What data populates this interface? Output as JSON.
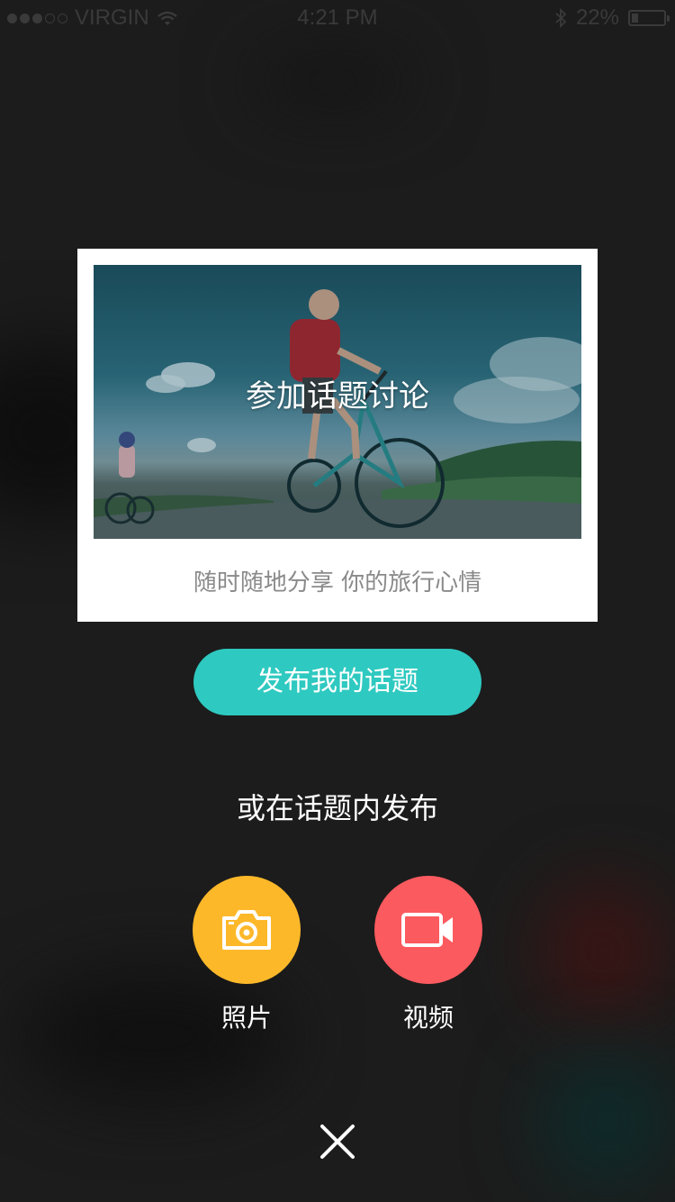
{
  "status_bar": {
    "carrier": "VIRGIN",
    "time": "4:21 PM",
    "battery_percent": "22%",
    "battery_level": 0.22,
    "signal_bars_filled": 3,
    "signal_bars_total": 5
  },
  "card": {
    "image_title": "参加话题讨论",
    "subtitle": "随时随地分享 你的旅行心情"
  },
  "publish_button_label": "发布我的话题",
  "or_text": "或在话题内发布",
  "actions": [
    {
      "label": "照片",
      "icon": "camera-icon",
      "color": "#fdb82a"
    },
    {
      "label": "视频",
      "icon": "video-camera-icon",
      "color": "#fb5a5f"
    }
  ],
  "colors": {
    "accent": "#2ec9c0",
    "overlay": "#1c1c1c"
  }
}
